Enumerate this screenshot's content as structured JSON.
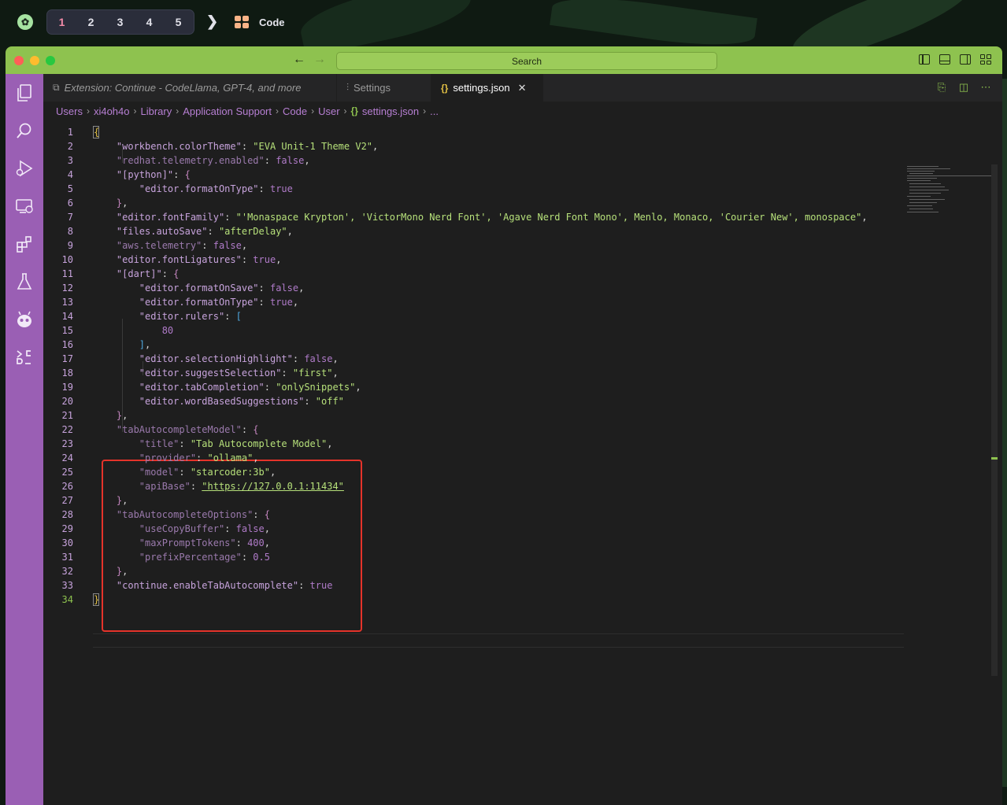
{
  "topbar": {
    "workspaces": [
      "1",
      "2",
      "3",
      "4",
      "5"
    ],
    "active_workspace": "1",
    "app_name": "Code"
  },
  "titlebar": {
    "search_label": "Search"
  },
  "tabs": [
    {
      "label": "Extension: Continue - CodeLlama, GPT-4, and more",
      "icon": "extensions-icon"
    },
    {
      "label": "Settings",
      "icon": "settings-sliders-icon"
    },
    {
      "label": "settings.json",
      "icon": "json-braces-icon",
      "icon_glyph": "{}",
      "active": true
    }
  ],
  "breadcrumbs": [
    "Users",
    "xi4oh4o",
    "Library",
    "Application Support",
    "Code",
    "User",
    "settings.json",
    "..."
  ],
  "editor": {
    "lines": [
      {
        "n": "1",
        "tokens": [
          [
            "br1",
            "{"
          ]
        ]
      },
      {
        "n": "2",
        "tokens": [
          [
            "k",
            "    \"workbench.colorTheme\""
          ],
          [
            "p",
            ": "
          ],
          [
            "s",
            "\"EVA Unit-1 Theme V2\""
          ],
          [
            "p",
            ","
          ]
        ]
      },
      {
        "n": "3",
        "tokens": [
          [
            "dim",
            "    \"redhat.telemetry.enabled\""
          ],
          [
            "p",
            ": "
          ],
          [
            "n",
            "false"
          ],
          [
            "p",
            ","
          ]
        ]
      },
      {
        "n": "4",
        "tokens": [
          [
            "k",
            "    \"[python]\""
          ],
          [
            "p",
            ": "
          ],
          [
            "br2",
            "{"
          ]
        ]
      },
      {
        "n": "5",
        "tokens": [
          [
            "k",
            "        \"editor.formatOnType\""
          ],
          [
            "p",
            ": "
          ],
          [
            "n",
            "true"
          ]
        ]
      },
      {
        "n": "6",
        "tokens": [
          [
            "br2",
            "    }"
          ],
          [
            "p",
            ","
          ]
        ]
      },
      {
        "n": "7",
        "tokens": [
          [
            "k",
            "    \"editor.fontFamily\""
          ],
          [
            "p",
            ": "
          ],
          [
            "s",
            "\"'Monaspace Krypton', 'VictorMono Nerd Font', 'Agave Nerd Font Mono', Menlo, Monaco, 'Courier New', monospace\""
          ],
          [
            "p",
            ","
          ]
        ]
      },
      {
        "n": "8",
        "tokens": [
          [
            "k",
            "    \"files.autoSave\""
          ],
          [
            "p",
            ": "
          ],
          [
            "s",
            "\"afterDelay\""
          ],
          [
            "p",
            ","
          ]
        ]
      },
      {
        "n": "9",
        "tokens": [
          [
            "dim",
            "    \"aws.telemetry\""
          ],
          [
            "p",
            ": "
          ],
          [
            "n",
            "false"
          ],
          [
            "p",
            ","
          ]
        ]
      },
      {
        "n": "10",
        "tokens": [
          [
            "k",
            "    \"editor.fontLigatures\""
          ],
          [
            "p",
            ": "
          ],
          [
            "n",
            "true"
          ],
          [
            "p",
            ","
          ]
        ]
      },
      {
        "n": "11",
        "tokens": [
          [
            "k",
            "    \"[dart]\""
          ],
          [
            "p",
            ": "
          ],
          [
            "br2",
            "{"
          ]
        ]
      },
      {
        "n": "12",
        "tokens": [
          [
            "k",
            "        \"editor.formatOnSave\""
          ],
          [
            "p",
            ": "
          ],
          [
            "n",
            "false"
          ],
          [
            "p",
            ","
          ]
        ]
      },
      {
        "n": "13",
        "tokens": [
          [
            "k",
            "        \"editor.formatOnType\""
          ],
          [
            "p",
            ": "
          ],
          [
            "n",
            "true"
          ],
          [
            "p",
            ","
          ]
        ]
      },
      {
        "n": "14",
        "tokens": [
          [
            "k",
            "        \"editor.rulers\""
          ],
          [
            "p",
            ": "
          ],
          [
            "br3",
            "["
          ]
        ]
      },
      {
        "n": "15",
        "tokens": [
          [
            "n",
            "            80"
          ]
        ]
      },
      {
        "n": "16",
        "tokens": [
          [
            "br3",
            "        ]"
          ],
          [
            "p",
            ","
          ]
        ]
      },
      {
        "n": "17",
        "tokens": [
          [
            "k",
            "        \"editor.selectionHighlight\""
          ],
          [
            "p",
            ": "
          ],
          [
            "n",
            "false"
          ],
          [
            "p",
            ","
          ]
        ]
      },
      {
        "n": "18",
        "tokens": [
          [
            "k",
            "        \"editor.suggestSelection\""
          ],
          [
            "p",
            ": "
          ],
          [
            "s",
            "\"first\""
          ],
          [
            "p",
            ","
          ]
        ]
      },
      {
        "n": "19",
        "tokens": [
          [
            "k",
            "        \"editor.tabCompletion\""
          ],
          [
            "p",
            ": "
          ],
          [
            "s",
            "\"onlySnippets\""
          ],
          [
            "p",
            ","
          ]
        ]
      },
      {
        "n": "20",
        "tokens": [
          [
            "k",
            "        \"editor.wordBasedSuggestions\""
          ],
          [
            "p",
            ": "
          ],
          [
            "s",
            "\"off\""
          ]
        ]
      },
      {
        "n": "21",
        "tokens": [
          [
            "br2",
            "    }"
          ],
          [
            "p",
            ","
          ]
        ]
      },
      {
        "n": "22",
        "tokens": [
          [
            "dim",
            "    \"tabAutocompleteModel\""
          ],
          [
            "p",
            ": "
          ],
          [
            "br2",
            "{"
          ]
        ]
      },
      {
        "n": "23",
        "tokens": [
          [
            "dim",
            "        \"title\""
          ],
          [
            "p",
            ": "
          ],
          [
            "s",
            "\"Tab Autocomplete Model\""
          ],
          [
            "p",
            ","
          ]
        ]
      },
      {
        "n": "24",
        "tokens": [
          [
            "dim",
            "        \"provider\""
          ],
          [
            "p",
            ": "
          ],
          [
            "s",
            "\"ollama\""
          ],
          [
            "p",
            ","
          ]
        ]
      },
      {
        "n": "25",
        "tokens": [
          [
            "dim",
            "        \"model\""
          ],
          [
            "p",
            ": "
          ],
          [
            "s",
            "\"starcoder:3b\""
          ],
          [
            "p",
            ","
          ]
        ]
      },
      {
        "n": "26",
        "tokens": [
          [
            "dim",
            "        \"apiBase\""
          ],
          [
            "p",
            ": "
          ],
          [
            "s",
            "\"https://127.0.0.1:11434\""
          ]
        ]
      },
      {
        "n": "27",
        "tokens": [
          [
            "br2",
            "    }"
          ],
          [
            "p",
            ","
          ]
        ]
      },
      {
        "n": "28",
        "tokens": [
          [
            "dim",
            "    \"tabAutocompleteOptions\""
          ],
          [
            "p",
            ": "
          ],
          [
            "br2",
            "{"
          ]
        ]
      },
      {
        "n": "29",
        "tokens": [
          [
            "dim",
            "        \"useCopyBuffer\""
          ],
          [
            "p",
            ": "
          ],
          [
            "n",
            "false"
          ],
          [
            "p",
            ","
          ]
        ]
      },
      {
        "n": "30",
        "tokens": [
          [
            "dim",
            "        \"maxPromptTokens\""
          ],
          [
            "p",
            ": "
          ],
          [
            "n",
            "400"
          ],
          [
            "p",
            ","
          ]
        ]
      },
      {
        "n": "31",
        "tokens": [
          [
            "dim",
            "        \"prefixPercentage\""
          ],
          [
            "p",
            ": "
          ],
          [
            "n",
            "0.5"
          ]
        ]
      },
      {
        "n": "32",
        "tokens": [
          [
            "br2",
            "    }"
          ],
          [
            "p",
            ","
          ]
        ]
      },
      {
        "n": "33",
        "tokens": [
          [
            "k",
            "    \"continue.enableTabAutocomplete\""
          ],
          [
            "p",
            ": "
          ],
          [
            "n",
            "true"
          ]
        ]
      },
      {
        "n": "34",
        "tokens": [
          [
            "br1",
            "}"
          ]
        ]
      }
    ]
  },
  "colors": {
    "titlebar": "#8ec24f",
    "activity_bar": "#9a5fb4",
    "highlight_box": "#e5332a"
  }
}
